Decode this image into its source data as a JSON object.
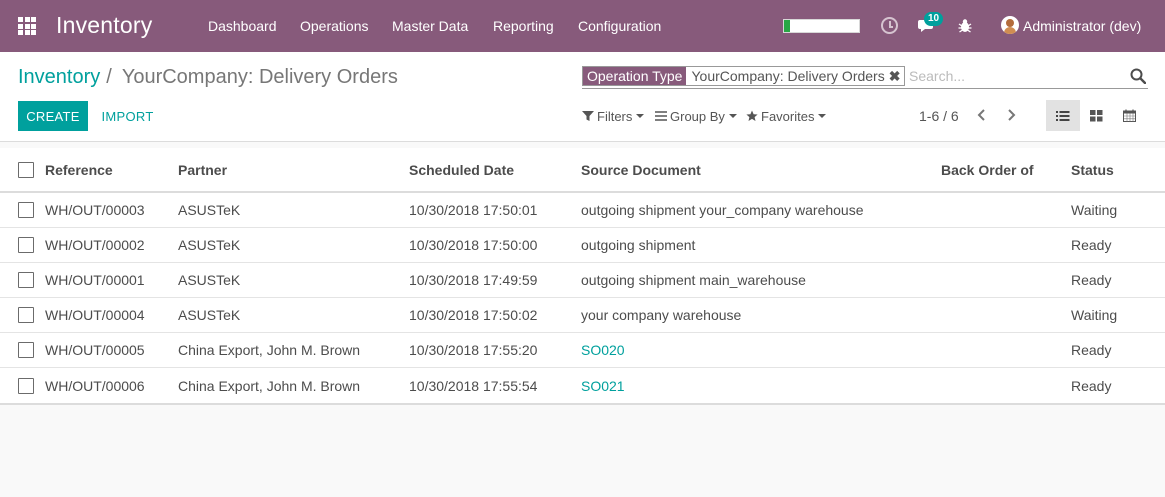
{
  "navbar": {
    "brand": "Inventory",
    "menu": {
      "dashboard": "Dashboard",
      "operations": "Operations",
      "master_data": "Master Data",
      "reporting": "Reporting",
      "configuration": "Configuration"
    },
    "messages_count": "10",
    "user_name": "Administrator (dev)",
    "progress_fraction": 0.08
  },
  "breadcrumb": {
    "parent": "Inventory",
    "current": "YourCompany: Delivery Orders"
  },
  "search": {
    "facet_category": "Operation Type",
    "facet_value": "YourCompany: Delivery Orders",
    "facet_remove": "✖",
    "placeholder": "Search..."
  },
  "buttons": {
    "create": "CREATE",
    "import": "IMPORT"
  },
  "filters": {
    "filters": "Filters",
    "group_by": "Group By",
    "favorites": "Favorites"
  },
  "pager": {
    "value": "1-6 / 6"
  },
  "table": {
    "headers": {
      "reference": "Reference",
      "partner": "Partner",
      "scheduled_date": "Scheduled Date",
      "source_document": "Source Document",
      "back_order_of": "Back Order of",
      "status": "Status"
    },
    "rows": [
      {
        "reference": "WH/OUT/00003",
        "partner": "ASUSTeK",
        "scheduled_date": "10/30/2018 17:50:01",
        "source_document": "outgoing shipment your_company warehouse",
        "back_order_of": "",
        "status": "Waiting"
      },
      {
        "reference": "WH/OUT/00002",
        "partner": "ASUSTeK",
        "scheduled_date": "10/30/2018 17:50:00",
        "source_document": "outgoing shipment",
        "back_order_of": "",
        "status": "Ready"
      },
      {
        "reference": "WH/OUT/00001",
        "partner": "ASUSTeK",
        "scheduled_date": "10/30/2018 17:49:59",
        "source_document": "outgoing shipment main_warehouse",
        "back_order_of": "",
        "status": "Ready"
      },
      {
        "reference": "WH/OUT/00004",
        "partner": "ASUSTeK",
        "scheduled_date": "10/30/2018 17:50:02",
        "source_document": "your company warehouse",
        "back_order_of": "",
        "status": "Waiting"
      },
      {
        "reference": "WH/OUT/00005",
        "partner": "China Export, John M. Brown",
        "scheduled_date": "10/30/2018 17:55:20",
        "source_document": "SO020",
        "back_order_of": "",
        "status": "Ready"
      },
      {
        "reference": "WH/OUT/00006",
        "partner": "China Export, John M. Brown",
        "scheduled_date": "10/30/2018 17:55:54",
        "source_document": "SO021",
        "back_order_of": "",
        "status": "Ready"
      }
    ]
  },
  "colors": {
    "navbar": "#875a7b",
    "accent": "#00a09d"
  }
}
